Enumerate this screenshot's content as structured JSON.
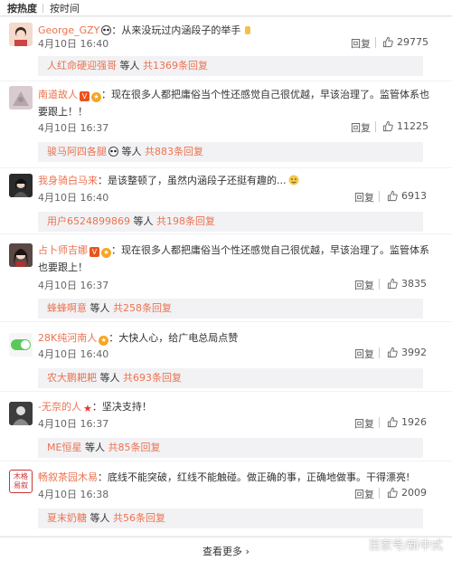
{
  "sort_tabs": {
    "hot": "按热度",
    "time": "按时间"
  },
  "comments": [
    {
      "user": "George_GZY",
      "text": "：从来没玩过内涵段子的举手",
      "time": "4月10日 16:40",
      "reply": "回复",
      "likes": "29775",
      "reply_preview": {
        "user": "人红命硬迎强哥",
        "mid": " 等人 ",
        "count": "共1369条回复"
      }
    },
    {
      "user": "南道故人",
      "text": "：现在很多人都把庸俗当个性还感觉自己很优越，早该治理了。监管体系也要跟上！！",
      "time": "4月10日 16:37",
      "reply": "回复",
      "likes": "11225",
      "reply_preview": {
        "user": "骏马阿四各腿",
        "mid": " 等人 ",
        "count": "共883条回复"
      }
    },
    {
      "user": "我身骑白马来",
      "text": "：是该整顿了，虽然内涵段子还挺有趣的...",
      "time": "4月10日 16:40",
      "reply": "回复",
      "likes": "6913",
      "reply_preview": {
        "user": "用户6524899869",
        "mid": " 等人 ",
        "count": "共198条回复"
      }
    },
    {
      "user": "占卜师吉娜",
      "text": "：现在很多人都把庸俗当个性还感觉自己很优越，早该治理了。监管体系也要跟上！",
      "time": "4月10日 16:37",
      "reply": "回复",
      "likes": "3835",
      "reply_preview": {
        "user": "蜂蜂啊意",
        "mid": " 等人 ",
        "count": "共258条回复"
      }
    },
    {
      "user": "28K纯河南人",
      "text": "：大快人心，给广电总局点赞",
      "time": "4月10日 16:40",
      "reply": "回复",
      "likes": "3992",
      "reply_preview": {
        "user": "农大鹏耙耙",
        "mid": " 等人 ",
        "count": "共693条回复"
      }
    },
    {
      "user": "-无奈的人",
      "text": "：坚决支持！",
      "time": "4月10日 16:37",
      "reply": "回复",
      "likes": "1926",
      "reply_preview": {
        "user": "ME恒星",
        "mid": " 等人 ",
        "count": "共85条回复"
      }
    },
    {
      "user": "畅叙茶园木易",
      "text": "：底线不能突破，红线不能触碰。做正确的事，正确地做事。干得漂亮!",
      "time": "4月10日 16:38",
      "reply": "回复",
      "likes": "2009",
      "reply_preview": {
        "user": "夏末奶糖",
        "mid": " 等人 ",
        "count": "共56条回复"
      }
    }
  ],
  "avatar_labels": {
    "c6": "木格\n易叙"
  },
  "footer": {
    "see_more": "查看更多 ›"
  },
  "watermark": "百家号/新中式",
  "colors": {
    "username": "#eb7350",
    "reply_bg": "#f2f2f5",
    "vip_badge": "#e8541e"
  }
}
